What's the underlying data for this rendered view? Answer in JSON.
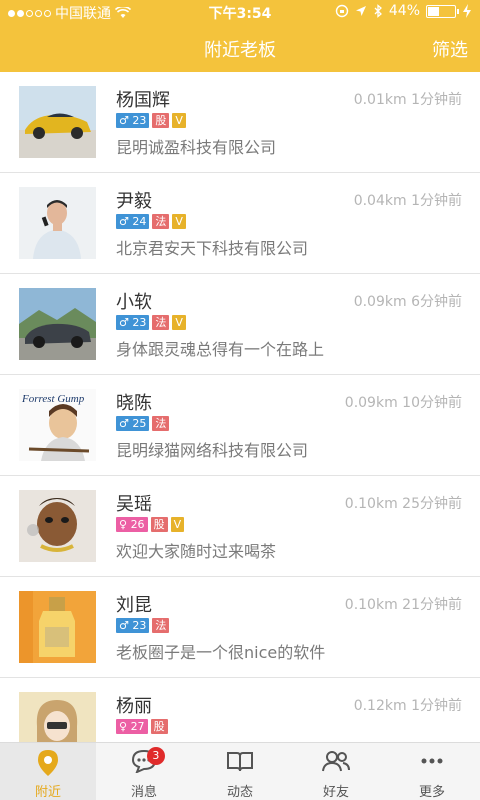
{
  "status_bar": {
    "carrier": "中国联通",
    "time": "下午3:54",
    "battery": "44%",
    "battery_level": 0.44
  },
  "nav": {
    "title": "附近老板",
    "filter_label": "筛选"
  },
  "entries": [
    {
      "name": "杨国辉",
      "gender": "♂",
      "age": "23",
      "tags": [
        "股",
        "V"
      ],
      "distance": "0.01km",
      "time": "1分钟前",
      "company": "昆明诚盈科技有限公司"
    },
    {
      "name": "尹毅",
      "gender": "♂",
      "age": "24",
      "tags": [
        "法",
        "V"
      ],
      "distance": "0.04km",
      "time": "1分钟前",
      "company": "北京君安天下科技有限公司"
    },
    {
      "name": "小软",
      "gender": "♂",
      "age": "23",
      "tags": [
        "法",
        "V"
      ],
      "distance": "0.09km",
      "time": "6分钟前",
      "company": "身体跟灵魂总得有一个在路上"
    },
    {
      "name": "晓陈",
      "gender": "♂",
      "age": "25",
      "tags": [
        "法"
      ],
      "distance": "0.09km",
      "time": "10分钟前",
      "company": "昆明绿猫网络科技有限公司",
      "avatar_text": "Forrest Gump"
    },
    {
      "name": "吴瑶",
      "gender": "♀",
      "age": "26",
      "tags": [
        "股",
        "V"
      ],
      "distance": "0.10km",
      "time": "25分钟前",
      "company": "欢迎大家随时过来喝茶"
    },
    {
      "name": "刘昆",
      "gender": "♂",
      "age": "23",
      "tags": [
        "法"
      ],
      "distance": "0.10km",
      "time": "21分钟前",
      "company": "老板圈子是一个很nice的软件"
    },
    {
      "name": "杨丽",
      "gender": "♀",
      "age": "27",
      "tags": [
        "股"
      ],
      "distance": "0.12km",
      "time": "1分钟前",
      "company": ""
    }
  ],
  "tabs": [
    {
      "label": "附近",
      "icon": "location-pin-icon"
    },
    {
      "label": "消息",
      "icon": "chat-bubble-icon",
      "badge": "3"
    },
    {
      "label": "动态",
      "icon": "open-book-icon"
    },
    {
      "label": "好友",
      "icon": "friends-icon"
    },
    {
      "label": "更多",
      "icon": "more-icon"
    }
  ]
}
